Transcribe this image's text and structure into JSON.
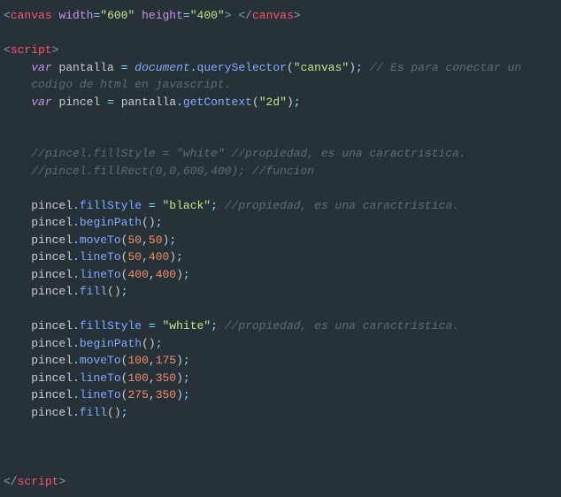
{
  "lines": {
    "l1": {
      "tagOpen": "<",
      "tagName": "canvas",
      "a1": "width",
      "eq": "=",
      "v1": "\"600\"",
      "a2": "height",
      "v2": "\"400\"",
      "tagClose": ">",
      "sp": " ",
      "endOpen": "</",
      "endName": "canvas",
      "endClose": ">"
    },
    "l3": {
      "tagOpen": "<",
      "tagName": "script",
      "tagClose": ">"
    },
    "l4": {
      "kw": "var",
      "name": "pantalla",
      "op": "=",
      "obj": "document",
      "dot": ".",
      "fn": "querySelector",
      "po": "(",
      "arg": "\"canvas\"",
      "pc": ")",
      "semi": ";",
      "c": "// Es para conectar un"
    },
    "l5": {
      "c": "codigo de html en javascript."
    },
    "l6": {
      "kw": "var",
      "name": "pincel",
      "op": "=",
      "obj": "pantalla",
      "dot": ".",
      "fn": "getContext",
      "po": "(",
      "arg": "\"2d\"",
      "pc": ")",
      "semi": ";"
    },
    "l9": {
      "c": "//pincel.fillStyle = \"white\" //propiedad, es una caractristica."
    },
    "l10": {
      "c": "//pincel.fillRect(0,0,600,400); //funcion"
    },
    "l12": {
      "obj": "pincel",
      "dot": ".",
      "prop": "fillStyle",
      "op": "=",
      "val": "\"black\"",
      "semi": ";",
      "c": "//propiedad, es una caractristica."
    },
    "l13": {
      "obj": "pincel",
      "dot": ".",
      "fn": "beginPath",
      "po": "(",
      "pc": ")",
      "semi": ";"
    },
    "l14": {
      "obj": "pincel",
      "dot": ".",
      "fn": "moveTo",
      "po": "(",
      "a1": "50",
      "comma": ",",
      "a2": "50",
      "pc": ")",
      "semi": ";"
    },
    "l15": {
      "obj": "pincel",
      "dot": ".",
      "fn": "lineTo",
      "po": "(",
      "a1": "50",
      "comma": ",",
      "a2": "400",
      "pc": ")",
      "semi": ";"
    },
    "l16": {
      "obj": "pincel",
      "dot": ".",
      "fn": "lineTo",
      "po": "(",
      "a1": "400",
      "comma": ",",
      "a2": "400",
      "pc": ")",
      "semi": ";"
    },
    "l17": {
      "obj": "pincel",
      "dot": ".",
      "fn": "fill",
      "po": "(",
      "pc": ")",
      "semi": ";"
    },
    "l19": {
      "obj": "pincel",
      "dot": ".",
      "prop": "fillStyle",
      "op": "=",
      "val": "\"white\"",
      "semi": ";",
      "c": "//propiedad, es una caractristica."
    },
    "l20": {
      "obj": "pincel",
      "dot": ".",
      "fn": "beginPath",
      "po": "(",
      "pc": ")",
      "semi": ";"
    },
    "l21": {
      "obj": "pincel",
      "dot": ".",
      "fn": "moveTo",
      "po": "(",
      "a1": "100",
      "comma": ",",
      "a2": "175",
      "pc": ")",
      "semi": ";"
    },
    "l22": {
      "obj": "pincel",
      "dot": ".",
      "fn": "lineTo",
      "po": "(",
      "a1": "100",
      "comma": ",",
      "a2": "350",
      "pc": ")",
      "semi": ";"
    },
    "l23": {
      "obj": "pincel",
      "dot": ".",
      "fn": "lineTo",
      "po": "(",
      "a1": "275",
      "comma": ",",
      "a2": "350",
      "pc": ")",
      "semi": ";"
    },
    "l24": {
      "obj": "pincel",
      "dot": ".",
      "fn": "fill",
      "po": "(",
      "pc": ")",
      "semi": ";"
    },
    "l28": {
      "tagOpen": "</",
      "tagName": "script",
      "tagClose": ">"
    }
  }
}
